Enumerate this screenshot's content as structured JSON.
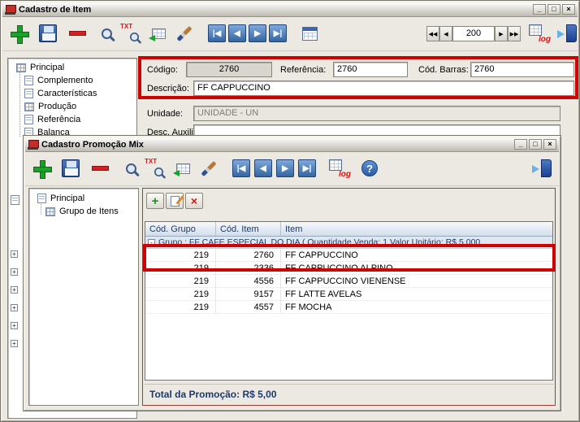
{
  "annotation_color": "#cf0202",
  "item_window": {
    "title": "Cadastro de Item",
    "window_controls": {
      "minimize": "_",
      "maximize": "□",
      "close": "×"
    },
    "toolbar": {
      "icon_names": [
        "add-icon",
        "save-icon",
        "delete-icon",
        "search-icon",
        "search-txt-icon",
        "transfer-icon",
        "brush-icon",
        "nav-first",
        "nav-prev",
        "nav-next",
        "nav-last",
        "calendar-icon",
        "log-icon",
        "exit-icon"
      ],
      "txt_label": "TXT",
      "log_label": "log",
      "nav_first": "|◀",
      "nav_prev": "◀",
      "nav_next": "▶",
      "nav_last": "▶|",
      "counter": {
        "first": "◀◀",
        "prev": "◀",
        "value": "200",
        "next": "▶",
        "last": "▶▶"
      }
    },
    "sidebar": [
      "Principal",
      "Complemento",
      "Características",
      "Produção",
      "Referência",
      "Balanca"
    ],
    "tree_expander_glyph": "+",
    "form": {
      "codigo": {
        "label": "Código:",
        "value": "2760"
      },
      "referencia": {
        "label": "Referência:",
        "value": "2760"
      },
      "cod_barras": {
        "label": "Cód. Barras:",
        "value": "2760"
      },
      "descricao": {
        "label": "Descrição:",
        "value": "FF CAPPUCCINO"
      },
      "unidade": {
        "label": "Unidade:",
        "value": "UNIDADE - UN"
      },
      "desc_auxiliar": {
        "label": "Desc. Auxiliar:",
        "value": ""
      }
    }
  },
  "promo_window": {
    "title": "Cadastro Promoção Mix",
    "window_controls": {
      "minimize": "_",
      "maximize": "□",
      "close": "×"
    },
    "toolbar": {
      "icon_names": [
        "add-icon",
        "save-icon",
        "delete-icon",
        "search-icon",
        "search-txt-icon",
        "transfer-icon",
        "brush-icon",
        "nav-first",
        "nav-prev",
        "nav-next",
        "nav-last",
        "log-icon",
        "help-icon",
        "exit-icon"
      ],
      "txt_label": "TXT",
      "log_label": "log",
      "help_label": "?",
      "nav_first": "|◀",
      "nav_prev": "◀",
      "nav_next": "▶",
      "nav_last": "▶|"
    },
    "sidebar": [
      "Principal",
      "Grupo de Itens"
    ],
    "minibar": {
      "add_glyph": "+",
      "delete_glyph": "×"
    },
    "grid": {
      "columns": [
        "Cód. Grupo",
        "Cód. Item",
        "Item"
      ],
      "collapse_glyph": "-",
      "group_header": "Grupo : FF CAFE ESPECIAL DO DIA (  Quantidade Venda: 1  Valor Unitário: R$ 5,000",
      "rows": [
        {
          "grupo": "219",
          "item_code": "2760",
          "item": "FF CAPPUCCINO"
        },
        {
          "grupo": "219",
          "item_code": "2336",
          "item": "FF CAPPUCCINO ALPINO"
        },
        {
          "grupo": "219",
          "item_code": "4556",
          "item": "FF CAPPUCCINO VIENENSE"
        },
        {
          "grupo": "219",
          "item_code": "9157",
          "item": "FF LATTE AVELAS"
        },
        {
          "grupo": "219",
          "item_code": "4557",
          "item": "FF MOCHA"
        }
      ]
    },
    "total": "Total da Promoção: R$ 5,00"
  }
}
